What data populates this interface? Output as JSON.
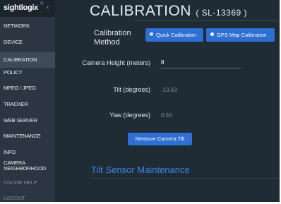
{
  "app": {
    "logo": "sightlogix",
    "logo_mark": "®",
    "collapse_icon": "‹"
  },
  "sidebar": {
    "items": [
      {
        "label": "NETWORK"
      },
      {
        "label": "DEVICE"
      },
      {
        "label": "CALIBRATION",
        "active": true
      },
      {
        "label": "POLICY"
      },
      {
        "label": "MPEG / JPEG"
      },
      {
        "label": "TRACKER"
      },
      {
        "label": "WEB SERVER"
      },
      {
        "label": "MAINTENANCE"
      },
      {
        "label": "INFO"
      },
      {
        "label": "CAMERA NEIGHBORHOOD"
      },
      {
        "label": "ONLINE HELP",
        "dim": true
      },
      {
        "label": "LOGOUT",
        "dim": true
      }
    ]
  },
  "header": {
    "title": "CALIBRATION",
    "subtitle": "( SL-13369 )"
  },
  "calibration": {
    "method_label": "Calibration Method",
    "quick_label": "Quick Calibration",
    "gps_label": "GPS Map Calibration",
    "selected": "quick",
    "height_label": "Camera Height (meters)",
    "height_value": "8",
    "tilt_label": "Tilt (degrees)",
    "tilt_value": "-13.63",
    "yaw_label": "Yaw (degrees)",
    "yaw_value": "0.64",
    "measure_button": "Measure Camera Tilt"
  },
  "section": {
    "title": "Tilt Sensor Maintenance"
  },
  "colors": {
    "accent": "#2d6fd2",
    "sidebar_bg": "#2b3642",
    "main_bg": "#1f2b35",
    "section_title": "#3d86e0"
  }
}
